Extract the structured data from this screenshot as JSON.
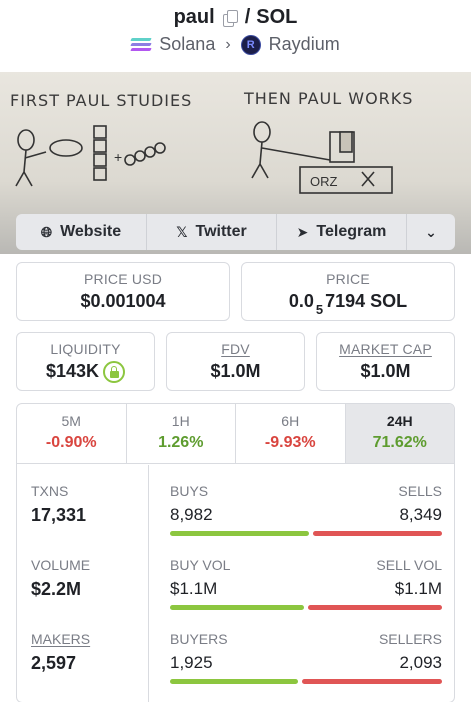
{
  "header": {
    "token": "paul",
    "pair_sep": "/",
    "quote": "SOL",
    "chain": "Solana",
    "dex": "Raydium",
    "icons": {
      "copy": "copy-icon",
      "chain": "solana-icon",
      "dex": "raydium-icon",
      "sep": "chevron-right-icon"
    }
  },
  "banner": {
    "left_text": "FIRST PAUL STUDIES",
    "right_text": "THEN PAUL WORKS",
    "sign_text": "ORZ"
  },
  "links": {
    "website": "Website",
    "twitter": "Twitter",
    "telegram": "Telegram",
    "more_icon": "chevron-down-icon"
  },
  "prices": {
    "usd_label": "PRICE USD",
    "usd_value": "$0.001004",
    "native_label": "PRICE",
    "native_prefix": "0.0",
    "native_zeros": "5",
    "native_digits": "7194 SOL"
  },
  "metrics": {
    "liquidity_label": "LIQUIDITY",
    "liquidity_value": "$143K",
    "fdv_label": "FDV",
    "fdv_value": "$1.0M",
    "mcap_label": "MARKET CAP",
    "mcap_value": "$1.0M"
  },
  "tabs": [
    {
      "label": "5M",
      "value": "-0.90%",
      "change": -0.9
    },
    {
      "label": "1H",
      "value": "1.26%",
      "change": 1.26
    },
    {
      "label": "6H",
      "value": "-9.93%",
      "change": -9.93
    },
    {
      "label": "24H",
      "value": "71.62%",
      "change": 71.62,
      "active": true
    }
  ],
  "stats": {
    "txns_label": "TXNS",
    "txns_value": "17,331",
    "volume_label": "VOLUME",
    "volume_value": "$2.2M",
    "makers_label": "MAKERS",
    "makers_value": "2,597",
    "rows": [
      {
        "left_label": "BUYS",
        "right_label": "SELLS",
        "left_value": "8,982",
        "right_value": "8,349",
        "left_share": 0.518
      },
      {
        "left_label": "BUY VOL",
        "right_label": "SELL VOL",
        "left_value": "$1.1M",
        "right_value": "$1.1M",
        "left_share": 0.5
      },
      {
        "left_label": "BUYERS",
        "right_label": "SELLERS",
        "left_value": "1,925",
        "right_value": "2,093",
        "left_share": 0.479
      }
    ]
  },
  "colors": {
    "positive": "#5e9c2f",
    "negative": "#d9453f",
    "bar_buy": "#8cc63f",
    "bar_sell": "#e05555"
  }
}
